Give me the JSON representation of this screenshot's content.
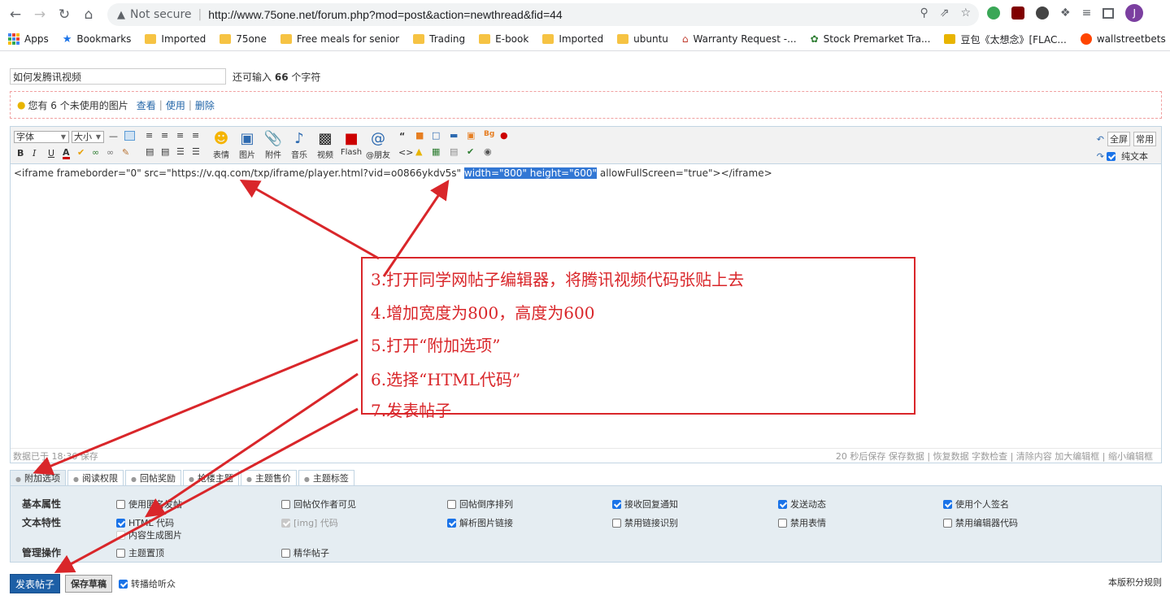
{
  "browser": {
    "security": "Not secure",
    "url": "http://www.75one.net/forum.php?mod=post&action=newthread&fid=44",
    "avatar_letter": "J",
    "bookmarks": [
      {
        "label": "Apps",
        "icon": "apps-grid-icon"
      },
      {
        "label": "Bookmarks",
        "icon": "star-icon"
      },
      {
        "label": "Imported",
        "icon": "folder-icon"
      },
      {
        "label": "75one",
        "icon": "folder-icon"
      },
      {
        "label": "Free meals for senior",
        "icon": "folder-icon"
      },
      {
        "label": "Trading",
        "icon": "folder-icon"
      },
      {
        "label": "E-book",
        "icon": "folder-icon"
      },
      {
        "label": "Imported",
        "icon": "folder-icon"
      },
      {
        "label": "ubuntu",
        "icon": "folder-icon"
      },
      {
        "label": "Warranty Request -...",
        "icon": "house-icon"
      },
      {
        "label": "Stock Premarket Tra...",
        "icon": "chameleon-icon"
      },
      {
        "label": "豆包《太想念》[FLAC...",
        "icon": "site-icon"
      },
      {
        "label": "wallstreetbets",
        "icon": "reddit-icon"
      }
    ]
  },
  "post": {
    "subject_value": "如何发腾讯视频",
    "subject_hint_pre": "还可输入",
    "subject_hint_count": "66",
    "subject_hint_post": "个字符"
  },
  "image_notice": {
    "text": "您有 6 个未使用的图片",
    "view": "查看",
    "use": "使用",
    "delete": "删除"
  },
  "toolbar": {
    "font_select": "字体",
    "size_select": "大小",
    "emoticon": "表情",
    "image": "图片",
    "attachment": "附件",
    "music": "音乐",
    "video": "视频",
    "flash": "Flash",
    "mention": "@朋友",
    "fullscreen": "全屏",
    "common": "常用",
    "plain_text": "纯文本"
  },
  "editor": {
    "code_before": "<iframe frameborder=\"0\" src=\"https://v.qq.com/txp/iframe/player.html?vid=o0866ykdv5s\" ",
    "code_highlight": "width=\"800\" height=\"600\"",
    "code_after": " allowFullScreen=\"true\"></iframe>",
    "status_left": "数据已于 18:36 保存",
    "status_right": "20 秒后保存 保存数据 | 恢复数据    字数检查 | 清除内容    加大编辑框 | 缩小编辑框"
  },
  "tabs": [
    "附加选项",
    "阅读权限",
    "回帖奖励",
    "抢楼主题",
    "主题售价",
    "主题标签"
  ],
  "options": {
    "basic_label": "基本属性",
    "text_label": "文本特性",
    "manage_label": "管理操作",
    "basic": [
      {
        "label": "使用匿名发帖",
        "checked": false
      },
      {
        "label": "回帖仅作者可见",
        "checked": false
      },
      {
        "label": "回帖倒序排列",
        "checked": false
      },
      {
        "label": "接收回复通知",
        "checked": true
      },
      {
        "label": "发送动态",
        "checked": true
      },
      {
        "label": "使用个人签名",
        "checked": true
      }
    ],
    "text": [
      {
        "label": "HTML 代码",
        "checked": true
      },
      {
        "label": "[img] 代码",
        "checked": true,
        "disabled": true
      },
      {
        "label": "解析图片链接",
        "checked": true
      },
      {
        "label": "禁用链接识别",
        "checked": false
      },
      {
        "label": "禁用表情",
        "checked": false
      },
      {
        "label": "禁用编辑器代码",
        "checked": false
      }
    ],
    "text_extra": {
      "label": "内容生成图片",
      "checked": false
    },
    "manage": [
      {
        "label": "主题置顶",
        "checked": false
      },
      {
        "label": "精华帖子",
        "checked": false
      }
    ]
  },
  "submit": {
    "post": "发表帖子",
    "draft": "保存草稿",
    "broadcast": "转播给听众",
    "rules": "本版积分规则"
  },
  "annotation": {
    "lines": [
      "3.打开同学网帖子编辑器，将腾讯视频代码张贴上去",
      "4.增加宽度为800，高度为600",
      "5.打开“附加选项”",
      "6.选择“HTML代码”",
      "7.发表帖子"
    ],
    "color": "#d9262a"
  }
}
